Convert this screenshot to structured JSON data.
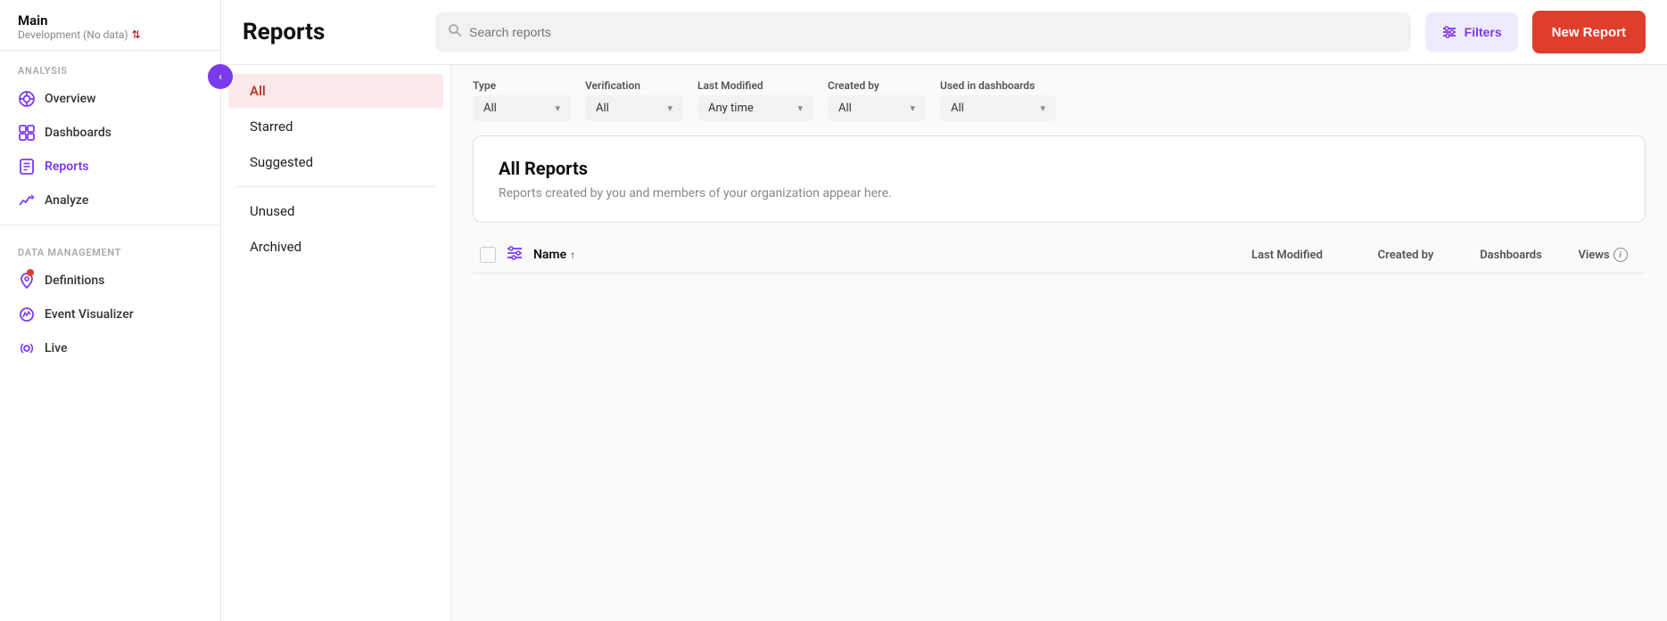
{
  "app": {
    "title": "Main",
    "subtitle": "Development (No data)",
    "collapse_btn": "‹"
  },
  "sidebar": {
    "analysis_label": "Analysis",
    "nav_items": [
      {
        "id": "overview",
        "label": "Overview",
        "icon": "overview-icon",
        "active": false
      },
      {
        "id": "dashboards",
        "label": "Dashboards",
        "icon": "dashboards-icon",
        "active": false
      },
      {
        "id": "reports",
        "label": "Reports",
        "icon": "reports-icon",
        "active": true
      },
      {
        "id": "analyze",
        "label": "Analyze",
        "icon": "analyze-icon",
        "active": false
      }
    ],
    "data_management_label": "Data Management",
    "data_items": [
      {
        "id": "definitions",
        "label": "Definitions",
        "icon": "definitions-icon",
        "badge": true
      },
      {
        "id": "event-visualizer",
        "label": "Event Visualizer",
        "icon": "event-visualizer-icon"
      },
      {
        "id": "live",
        "label": "Live",
        "icon": "live-icon"
      }
    ]
  },
  "top_bar": {
    "page_title": "Reports",
    "search_placeholder": "Search reports",
    "filters_label": "Filters",
    "new_report_label": "New Report"
  },
  "left_nav": {
    "items": [
      {
        "id": "all",
        "label": "All",
        "active": true
      },
      {
        "id": "starred",
        "label": "Starred",
        "active": false
      },
      {
        "id": "suggested",
        "label": "Suggested",
        "active": false
      },
      {
        "id": "unused",
        "label": "Unused",
        "active": false
      },
      {
        "id": "archived",
        "label": "Archived",
        "active": false
      }
    ]
  },
  "filters": {
    "type": {
      "label": "Type",
      "value": "All"
    },
    "verification": {
      "label": "Verification",
      "value": "All"
    },
    "last_modified": {
      "label": "Last Modified",
      "value": "Any time"
    },
    "created_by": {
      "label": "Created by",
      "value": "All"
    },
    "used_in_dashboards": {
      "label": "Used in dashboards",
      "value": "All"
    }
  },
  "all_reports": {
    "title": "All Reports",
    "description": "Reports created by you and members of your organization appear here."
  },
  "table": {
    "col_name": "Name",
    "col_name_sort": "↑",
    "col_last_modified": "Last Modified",
    "col_created_by": "Created by",
    "col_dashboards": "Dashboards",
    "col_views": "Views"
  }
}
